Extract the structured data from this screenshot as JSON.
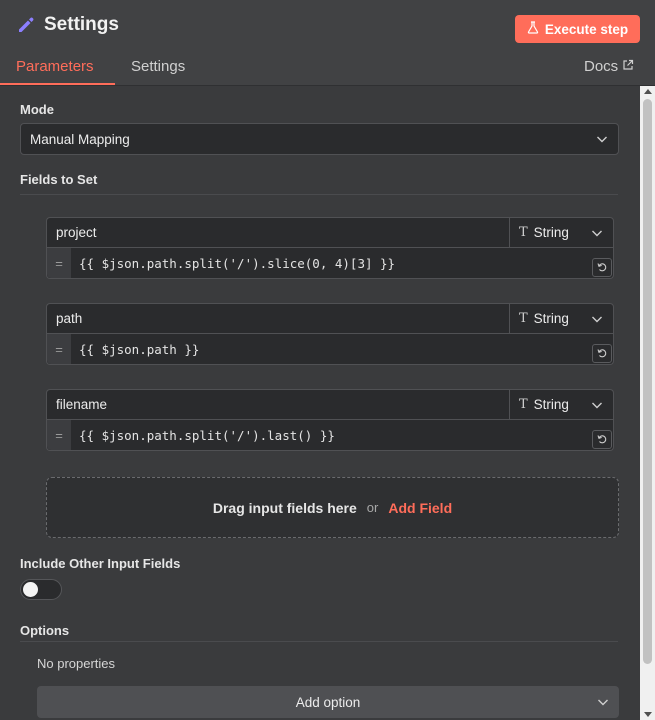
{
  "header": {
    "title": "Settings",
    "execute_label": "Execute step",
    "tabs": [
      {
        "label": "Parameters",
        "active": true
      },
      {
        "label": "Settings",
        "active": false
      }
    ],
    "docs_label": "Docs"
  },
  "mode": {
    "label": "Mode",
    "value": "Manual Mapping"
  },
  "fields_section": {
    "label": "Fields to Set",
    "fields": [
      {
        "name": "project",
        "type": "String",
        "value": "{{ $json.path.split('/').slice(0, 4)[3] }}"
      },
      {
        "name": "path",
        "type": "String",
        "value": "{{ $json.path }}"
      },
      {
        "name": "filename",
        "type": "String",
        "value": "{{ $json.path.split('/').last() }}"
      }
    ],
    "eq_symbol": "=",
    "dropzone_text": "Drag input fields here",
    "dropzone_or": "or",
    "add_field_label": "Add Field"
  },
  "include_other": {
    "label": "Include Other Input Fields",
    "enabled": false
  },
  "options": {
    "label": "Options",
    "empty_text": "No properties",
    "add_option_label": "Add option"
  },
  "colors": {
    "accent": "#ff6d5a",
    "icon_purple": "#8c7fff"
  },
  "icons": {
    "title": "pencil-icon",
    "execute": "flask-icon",
    "docs": "external-link-icon",
    "type": "text-type-icon",
    "dropdown": "chevron-down-icon",
    "refresh": "refresh-icon"
  }
}
